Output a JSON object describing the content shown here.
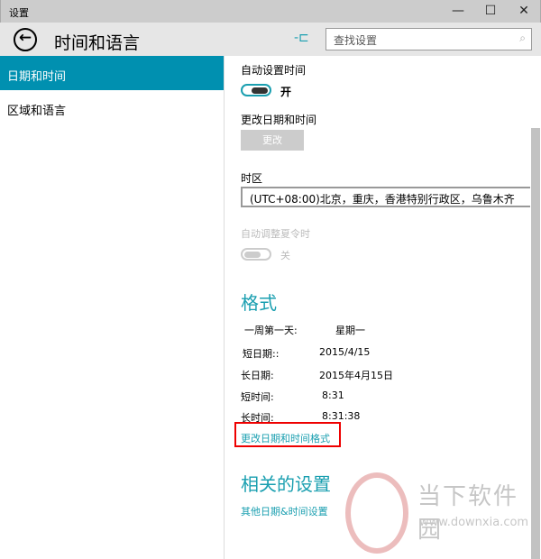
{
  "window": {
    "title": "设置",
    "minimize": "—",
    "maximize": "☐",
    "close": "✕"
  },
  "header": {
    "title": "时间和语言",
    "back_icon": "back-arrow",
    "pin_icon": "pin",
    "search_placeholder": "查找设置",
    "search_icon": "⌕"
  },
  "sidebar": {
    "items": [
      {
        "label": "日期和时间",
        "active": true
      },
      {
        "label": "区域和语言",
        "active": false
      }
    ]
  },
  "content": {
    "auto_time": {
      "label": "自动设置时间",
      "state": "开"
    },
    "change_dt": {
      "label": "更改日期和时间",
      "button": "更改"
    },
    "timezone": {
      "label": "时区",
      "value": "(UTC+08:00)北京，重庆，香港特别行政区，乌鲁木齐"
    },
    "dst": {
      "label": "自动调整夏令时",
      "state": "关"
    },
    "format": {
      "heading": "格式",
      "rows": [
        {
          "k": "一周第一天:",
          "v": "星期一"
        },
        {
          "k": "短日期::",
          "v": "2015/4/15"
        },
        {
          "k": "长日期:",
          "v": "2015年4月15日"
        },
        {
          "k": "短时间:",
          "v": "8:31"
        },
        {
          "k": "长时间:",
          "v": "8:31:38"
        }
      ],
      "link": "更改日期和时间格式"
    },
    "related": {
      "heading": "相关的设置",
      "link": "其他日期&时间设置"
    }
  },
  "watermark": {
    "name": "当下软件园",
    "url": "www.downxia.com"
  }
}
